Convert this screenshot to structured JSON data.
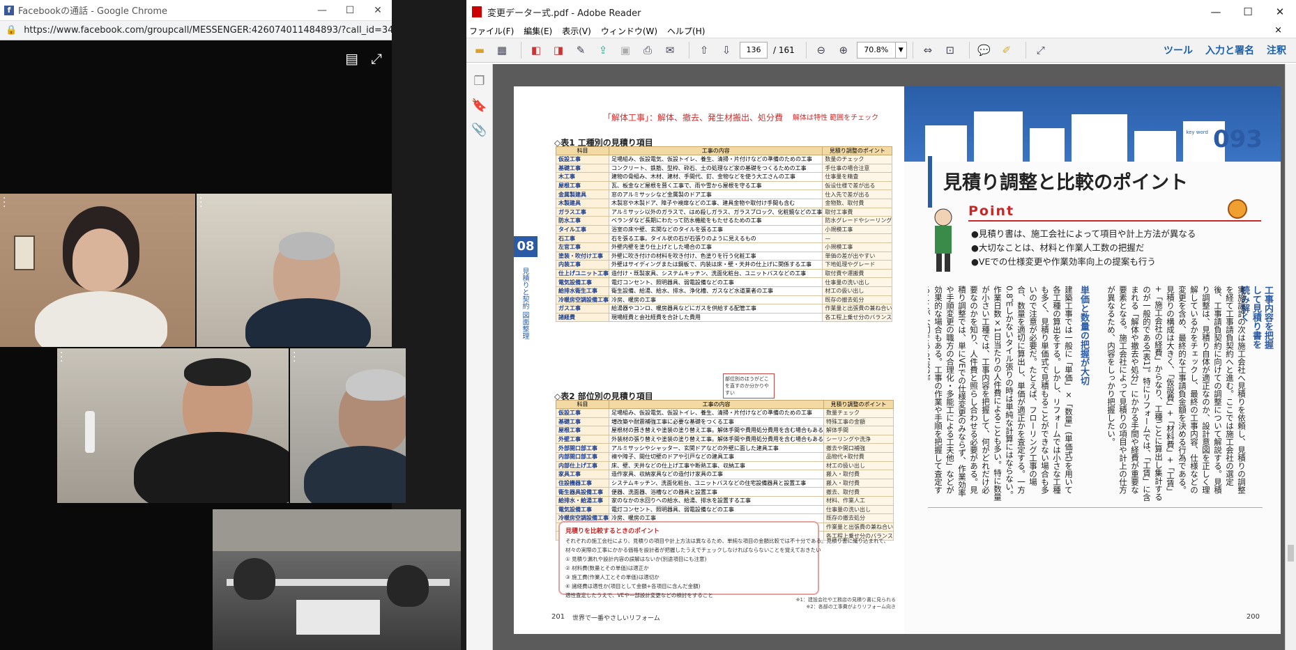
{
  "chrome": {
    "title": "Facebookの通話 - Google Chrome",
    "url": "https://www.facebook.com/groupcall/MESSENGER:426074011484893/?call_id=3455390723&u...",
    "min": "—",
    "max": "☐",
    "close": "✕"
  },
  "call": {
    "layout_icon": "layout-icon",
    "fullscreen_icon": "fullscreen-icon"
  },
  "reader": {
    "title": "変更データー式.pdf - Adobe Reader",
    "min": "—",
    "max": "☐",
    "close": "✕",
    "menu": [
      "ファイル(F)",
      "編集(E)",
      "表示(V)",
      "ウィンドウ(W)",
      "ヘルプ(H)"
    ],
    "menu_close": "×",
    "page_current": "136",
    "page_total": "/ 161",
    "zoom": "70.8%",
    "links": [
      "ツール",
      "入力と署名",
      "注釈"
    ]
  },
  "left_page": {
    "handnote1": "「解体工事」：解体、撤去、発生材搬出、処分費",
    "handnote2": "解体は特性 範囲をチェック",
    "tab": "08",
    "side": "見積りと契約 図面整理",
    "table1_title": "◇表1 工種別の見積り項目",
    "table2_title": "◇表2 部位別の見積り項目",
    "headers": [
      "科目",
      "工事の内容",
      "見積り調整のポイント"
    ],
    "table1": [
      [
        "仮設工事",
        "足場組み、仮設電気、仮設トイレ、養生、清掃・片付けなどの準備のための工事",
        "数量のチェック"
      ],
      [
        "基礎工事",
        "コンクリート、鉄筋、型枠、砕石、土の処理など家の基礎をつくるための工事",
        "手仕事の場合注意"
      ],
      [
        "木工事",
        "建物の骨組み、木材、建材、手間代、釘、金物などを使う大工さんの工事",
        "仕事量を精査"
      ],
      [
        "屋根工事",
        "瓦、板金など屋根を葺く工事で、雨や雪から屋根を守る工事",
        "仮设仕様で差が出る"
      ],
      [
        "金属製建具",
        "窓のアルミサッシなど金属製のドア工事",
        "仕入先で差が出る"
      ],
      [
        "木製建具",
        "木製窓や木製ドア、障子や襖扉などの工事、建具金物や取付け手間も含む",
        "金物数、取付費"
      ],
      [
        "ガラス工事",
        "アルミサッシ以外のガラスで、はめ殺しガラス、ガラスブロック、化粧鏡などの工事",
        "取付工事費"
      ],
      [
        "防水工事",
        "ベランダなど長期にわたって防水機能をもたせるための工事",
        "防水グレードやシーリング"
      ],
      [
        "タイル工事",
        "浴室の床や壁、玄関などのタイルを張る工事",
        "小規模工事"
      ],
      [
        "石工事",
        "石を張る工事。タイル状の石が石張りのように見えるもの",
        "—"
      ],
      [
        "左官工事",
        "外壁内壁を塗り仕上げとした場合の工事",
        "小規模工事"
      ],
      [
        "塗装・吹付け工事",
        "外壁に吹き付けの材料を吹き付け、色塗りを行う化粧工事",
        "単価の差が出やすい"
      ],
      [
        "内装工事",
        "外壁はサイディングまたは鋼板で、内装は床・壁・天井の仕上げに関係する工事",
        "下地処理やグレード"
      ],
      [
        "仕上げユニット工事",
        "造付け・既製家具、システムキッチン、洗面化粧台、ユニットバスなどの工事",
        "取付費や運搬費"
      ],
      [
        "電気設備工事",
        "電灯コンセント、照明器具、弱電設備などの工事",
        "仕事量の洗い出し"
      ],
      [
        "給排水衛生工事",
        "衛生設備、給湯、給水、排水、浄化槽、ガスなど水道業者の工事",
        "材工の扱い出し"
      ],
      [
        "冷暖房空調設備工事",
        "冷房、暖房の工事",
        "既存の撤去処分"
      ],
      [
        "ガス工事",
        "給湯器やコンロ、暖房器具などにガスを供給する配管工事",
        "作業量と出張費の兼ね合い"
      ],
      [
        "諸経費",
        "現場経費と会社経費を合計した費用",
        "各工程上乗せ分のバランス"
      ]
    ],
    "note": "部位別のほうがどこを直すのか分かりやすい",
    "table2": [
      [
        "仮設工事",
        "足場組み、仮設電気、仮設トイレ、養生、清掃・片付けなどの準備のための工事",
        "数量チェック"
      ],
      [
        "基礎工事",
        "増改築や耐震補強工事に必要な基礎をつくる工事",
        "特殊工事の金額"
      ],
      [
        "屋根工事",
        "屋根材の葺き替えや塗装の塗り替え工事。解体手間や費用処分費用を含む場合もある",
        "解体手間"
      ],
      [
        "外壁工事",
        "外装材の張り替えや塗装の塗り替え工事。解体手間や費用処分費用を含む場合もある",
        "シーリングや洗浄"
      ],
      [
        "外部開口部工事",
        "アルミサッシやシャッター、玄関ドアなどの外壁に面した建具工事",
        "撤去や開口補強"
      ],
      [
        "内部開口部工事",
        "襖や障子、間仕切壁のドアや引戸などの建具工事",
        "品物代+取付費"
      ],
      [
        "内部仕上げ工事",
        "床、壁、天井などの仕上げ工事や断熱工事、収納工事",
        "材工の扱い出し"
      ],
      [
        "家具工事",
        "造作家具、収納家具などの造付け家具の工事",
        "搬入・取付費"
      ],
      [
        "住設機器工事",
        "システムキッチン、洗面化粧台、ユニットバスなどの住宅設備器具と設置工事",
        "搬入・取付費"
      ],
      [
        "衛生器具設備工事",
        "便器、洗面器、浴槽などの器具と設置工事",
        "撤去、取付費"
      ],
      [
        "給排水・給湯工事",
        "家のなかの水回りへの給水、給湯、排水を設置する工事",
        "材料、作業人工"
      ],
      [
        "電気設備工事",
        "電灯コンセント、照明器具、弱電設備などの工事",
        "仕事量の洗い出し"
      ],
      [
        "冷暖房空調設備工事",
        "冷房、暖房の工事",
        "既存の撤去処分"
      ],
      [
        "ガス工事",
        "給湯器やコンロ、暖房器具などにガスを供給する配管工事",
        "作業量と出張費の兼ね合い"
      ],
      [
        "諸経費",
        "現場経費と会社経費を合計した費用",
        "各工程上乗せ分のバランス"
      ]
    ],
    "compare_title": "見積りを比較するときのポイント",
    "compare_lines": [
      "それぞれの施工会社により、見積りの項目や計上方法は異なるため、単純な項目の金額比較では不十分である。見積り書に織り込まれて、",
      "材々の実際の工事にかかる価格を設計者が把握したうえでチェックしなければならないことを覚えておきたい",
      "① 見積り漏れや設計内容の誤解はないか(別途項目にも注意)",
      "② 材料費(数量とその単価)は適正か",
      "③ 施工費(作業人工とその単価)は適切か",
      "④ 諸経費は適性か(項目として金額+各項目に含んだ金額)",
      "適性査定したうえで、VEや一部設計変更などの検討をすること"
    ],
    "footnote1": "※1：建設会社や工務店の見積り書に見られる",
    "footnote2": "※2：各部の工事費がよりリフォーム向き",
    "page_number": "201",
    "book": "世界で一番やさしいリフォーム"
  },
  "right_page": {
    "key_label": "key word",
    "key_number": "093",
    "title": "見積り調整と比較のポイント",
    "point": "Point",
    "bullets": [
      "●見積り書は、施工会社によって項目や計上方法が異なる",
      "●大切なことは、材料と作業人工数の把握だ",
      "●VEでの仕様変更や作業効率向上の提案も行う"
    ],
    "head1": "工事内容を把握して見積り書を読み解く",
    "body1": "実施設計の次は施工会社へ見積りを依頼し、見積りの調整を経て工事請負契約へと進む。ここでは施工会社の選定後、工事請負契約に向けての調整について解説する。見積り調整は、見積り自体が適正なのか、設計意図を正しく理解しているかをチェックし、最終の工事内容、仕様などの変更を含め、最終的な工事請負金額を決める行為である。見積りの構成は大きく、「仮設費」+「材料費」+「工賃」+「施工会社の経費」からなり、工種ごとに算出し集計するのが一般的である[表1]。特にリフォームでは、「工賃」に含まれる「解体や撤去や処分」にかかる手間や経費が重要な要素となる。施工会社によって見積りの項目や計上の仕方が異なるため、内容をしっかり把握したい。",
    "head2": "単価と数量の把握が大切",
    "body2": "建築工事では一般に「単価」×「数量」(単価式)を用いて各工種の算出をする。しかし、リフォームでは小さな工種も多く、見積り単価式で見積もることができない場合も多いので注意が必要だ。たとえば、フローリング工事の場合、数量を適切に算出し、単価が適正かを査定する。一方0.8㎡しかないタイル張りの時は単純な計算にはならない。作業日数×1日当たりの人件費によることも多い。特に数量が小さい工種では、工事内容を把握して、何がどれだけ必要なのかを知り、人件費と照らし合わせる必要がある。見積り調整では、単にVEでの仕様変更のみならず、作業効率や手順変更の職方の合理化・多能工による工夫他」などが効果的な場合もある。工事の作業や手順を把握して査定することが大切である[表2]。",
    "page_number": "200"
  }
}
